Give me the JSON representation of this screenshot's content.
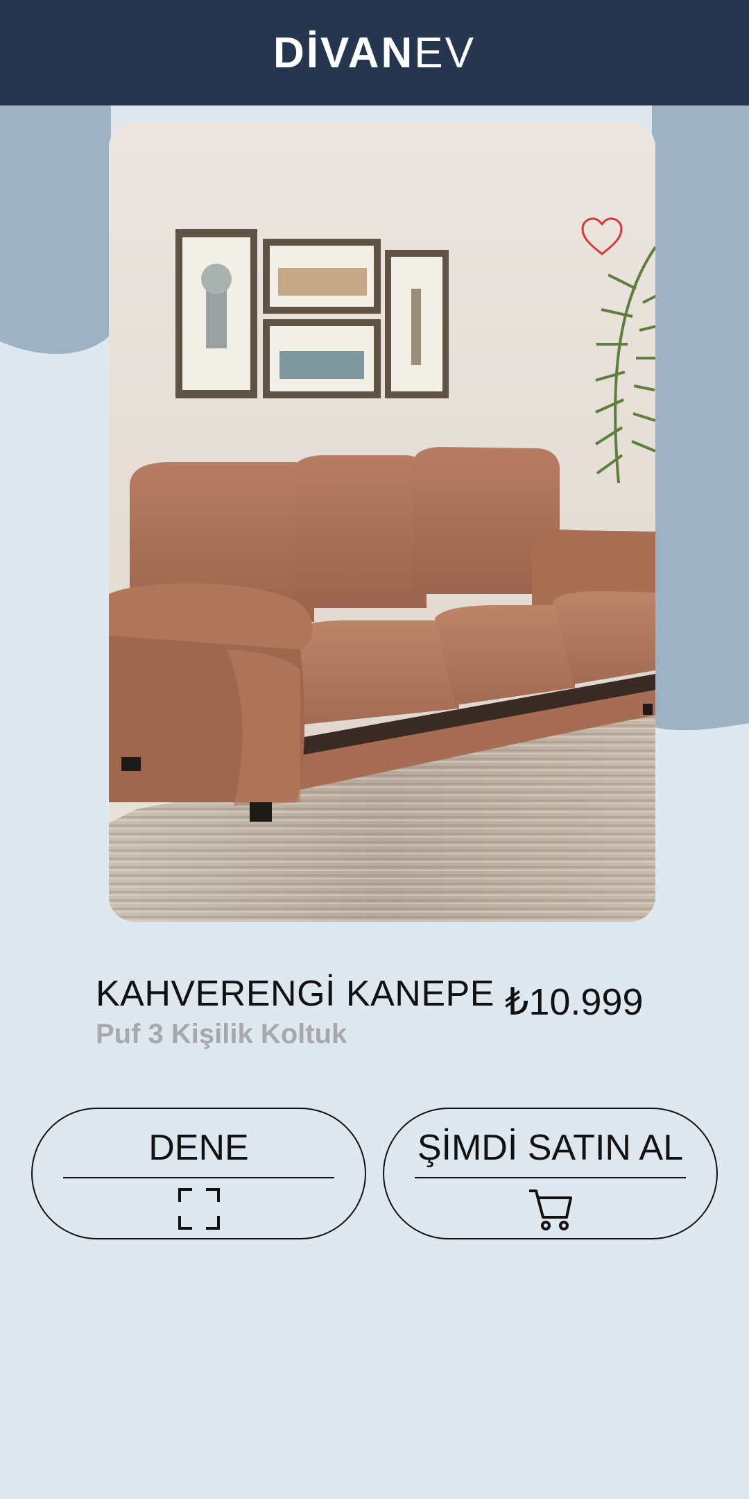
{
  "header": {
    "brand_bold": "DİVAN",
    "brand_light": "EV"
  },
  "product": {
    "title": "KAHVERENGİ KANEPE",
    "subtitle": "Puf 3 Kişilik Koltuk",
    "price": "₺10.999",
    "image": "brown-three-seat-sofa-photo"
  },
  "actions": {
    "try_label": "DENE",
    "try_icon": "ar-scan-icon",
    "buy_label": "ŞİMDİ SATIN AL",
    "buy_icon": "shopping-cart-icon",
    "favorite_icon": "heart-outline-icon"
  },
  "colors": {
    "header": "#26364f",
    "background": "#dfe7ef",
    "wave": "#9db2c3",
    "favorite": "#d63a3a",
    "subtitle": "#a6a8ab"
  }
}
